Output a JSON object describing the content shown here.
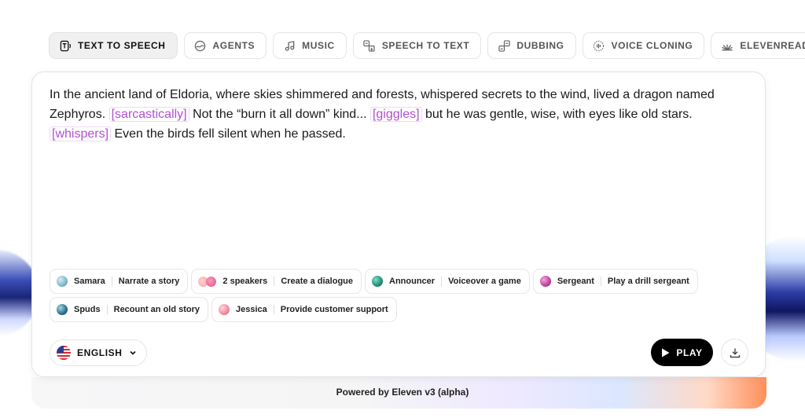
{
  "tabs": [
    {
      "label": "TEXT TO SPEECH",
      "icon": "text-to-speech-icon",
      "active": true
    },
    {
      "label": "AGENTS",
      "icon": "agents-icon",
      "active": false
    },
    {
      "label": "MUSIC",
      "icon": "music-note-icon",
      "active": false
    },
    {
      "label": "SPEECH TO TEXT",
      "icon": "speech-to-text-icon",
      "active": false
    },
    {
      "label": "DUBBING",
      "icon": "dubbing-icon",
      "active": false
    },
    {
      "label": "VOICE CLONING",
      "icon": "voice-cloning-icon",
      "active": false
    },
    {
      "label": "ELEVENREADER",
      "icon": "elevenreader-icon",
      "active": false
    }
  ],
  "editor": {
    "seg1": "In the ancient land of Eldoria, where skies shimmered and forests, whispered secrets to the wind, lived a dragon named Zephyros. ",
    "tag1": "[sarcastically]",
    "seg2": " Not the “burn it all down” kind... ",
    "tag2": "[giggles]",
    "seg3": " but he was gentle, wise, with eyes like old stars. ",
    "tag3": "[whispers]",
    "seg4": " Even the birds fell silent when he passed."
  },
  "chips": [
    {
      "voice": "Samara",
      "prompt": "Narrate a story",
      "avatar_colors": [
        "#7fb6c9"
      ]
    },
    {
      "voice": "2 speakers",
      "prompt": "Create a dialogue",
      "avatar_colors": [
        "#f4a3b5",
        "#e0527a"
      ]
    },
    {
      "voice": "Announcer",
      "prompt": "Voiceover a game",
      "avatar_colors": [
        "#1f8f7a"
      ]
    },
    {
      "voice": "Sergeant",
      "prompt": "Play a drill sergeant",
      "avatar_colors": [
        "#c2409a"
      ]
    },
    {
      "voice": "Spuds",
      "prompt": "Recount an old story",
      "avatar_colors": [
        "#2a6f8a"
      ]
    },
    {
      "voice": "Jessica",
      "prompt": "Provide customer support",
      "avatar_colors": [
        "#f08ba0"
      ]
    }
  ],
  "language": {
    "label": "ENGLISH",
    "flag": "us-flag-icon"
  },
  "play": {
    "label": "PLAY"
  },
  "footer": {
    "text": "Powered by Eleven v3 (alpha)"
  },
  "colors": {
    "tag": "#b24fd1",
    "play_bg": "#000000",
    "accent_orange": "#ff8f5a"
  }
}
